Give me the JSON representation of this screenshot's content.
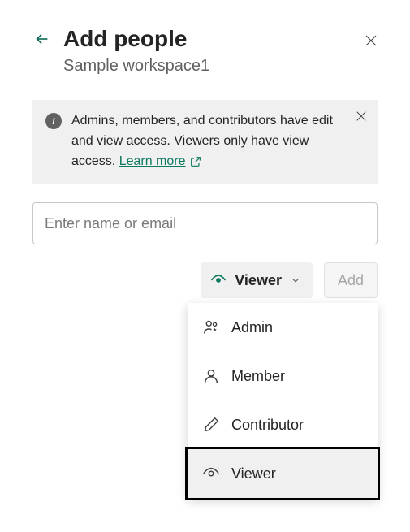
{
  "header": {
    "title": "Add people",
    "subtitle": "Sample workspace1"
  },
  "banner": {
    "text": "Admins, members, and contributors have edit and view access. Viewers only have view access. ",
    "learn_more": "Learn more"
  },
  "input": {
    "placeholder": "Enter name or email"
  },
  "controls": {
    "role_label": "Viewer",
    "add_label": "Add"
  },
  "roles": {
    "items": [
      {
        "label": "Admin"
      },
      {
        "label": "Member"
      },
      {
        "label": "Contributor"
      },
      {
        "label": "Viewer"
      }
    ]
  }
}
